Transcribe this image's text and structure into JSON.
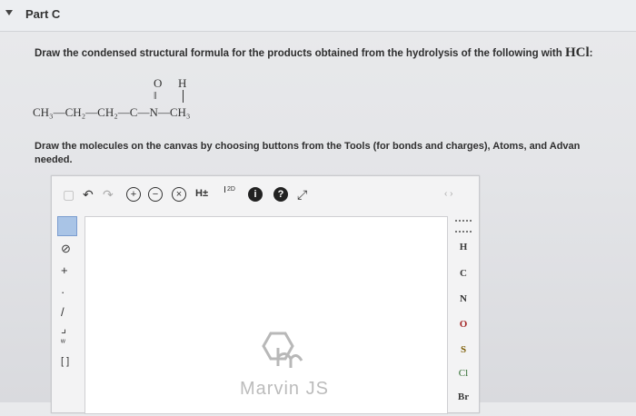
{
  "header": {
    "part_title": "Part C"
  },
  "question": {
    "text": "Draw the condensed structural formula for the products obtained from the hydrolysis of the following with ",
    "reagent": "HCl",
    "reagent_suffix": ":"
  },
  "formula": {
    "top_o": "O",
    "top_h": "H",
    "double_bond": "‖",
    "chain": "CH₃—CH₂—CH₂—C—N—CH₃"
  },
  "instruction": {
    "line1": "Draw the molecules on the canvas by choosing buttons from the Tools (for bonds and charges), Atoms, and Advan",
    "line2": "needed."
  },
  "toolbar": {
    "hpm": "H±",
    "two_d": "2D",
    "info": "i",
    "help": "?"
  },
  "periodic": [
    "H",
    "C",
    "N",
    "O",
    "S",
    "Cl",
    "Br"
  ],
  "watermark": "Marvin JS",
  "colors": {
    "active_tool": "#a9c4e6",
    "oxygen": "#a52a2a"
  }
}
